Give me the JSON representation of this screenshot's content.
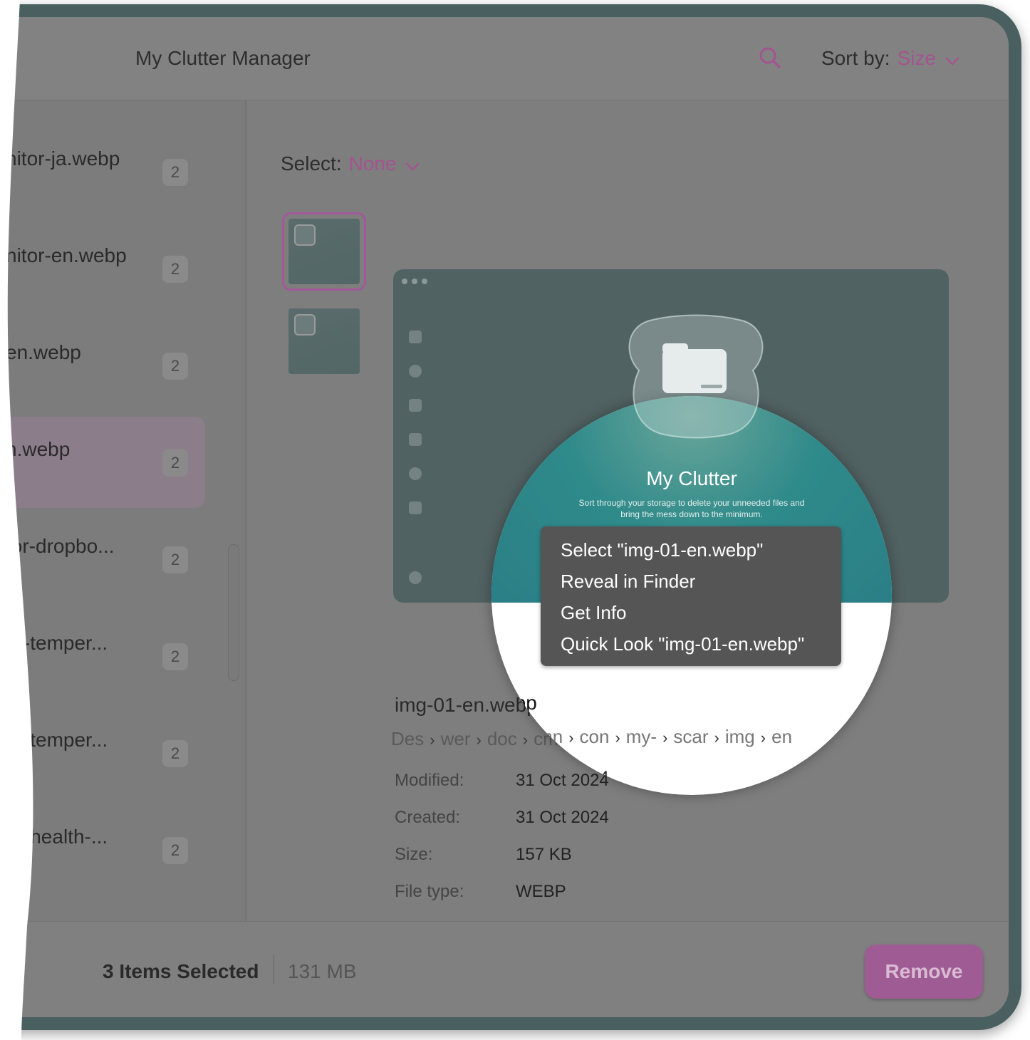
{
  "app": {
    "title": "My Clutter Manager"
  },
  "toolbar": {
    "sort_label": "Sort by:",
    "sort_value": "Size"
  },
  "sidebar": {
    "items": [
      {
        "label": "nitor-ja.webp",
        "count": "2"
      },
      {
        "label": "nitor-en.webp",
        "count": "2"
      },
      {
        "label": "en.webp",
        "count": "2"
      },
      {
        "label": "n.webp",
        "count": "2"
      },
      {
        "label": "tor-dropbo...",
        "count": "2"
      },
      {
        "label": "or-temper...",
        "count": "2"
      },
      {
        "label": "or-temper...",
        "count": "2"
      },
      {
        "label": "or-health-...",
        "count": "2"
      }
    ]
  },
  "main": {
    "select_label": "Select:",
    "select_value": "None",
    "preview": {
      "title": "My Clutter",
      "subtitle_line1": "Sort through your storage to delete your unneeded files and",
      "subtitle_line2": "bring the mess down to the minimum."
    },
    "context_menu": [
      "Select \"img-01-en.webp\"",
      "Reveal in Finder",
      "Get Info",
      "Quick Look \"img-01-en.webp\""
    ],
    "file": {
      "name": "img-01-en.webp",
      "path": [
        "Des",
        "wer",
        "doc",
        "cmn",
        "con",
        "my-",
        "scar",
        "img",
        "en"
      ],
      "meta": [
        {
          "key": "Modified:",
          "value": "31 Oct 2024"
        },
        {
          "key": "Created:",
          "value": "31 Oct 2024"
        },
        {
          "key": "Size:",
          "value": "157 KB"
        },
        {
          "key": "File type:",
          "value": "WEBP"
        }
      ]
    }
  },
  "footer": {
    "selected_count": "3 Items Selected",
    "selected_size": "131 MB",
    "remove_label": "Remove"
  },
  "colors": {
    "accent": "#a4548f",
    "teal": "#2f8a8a"
  }
}
